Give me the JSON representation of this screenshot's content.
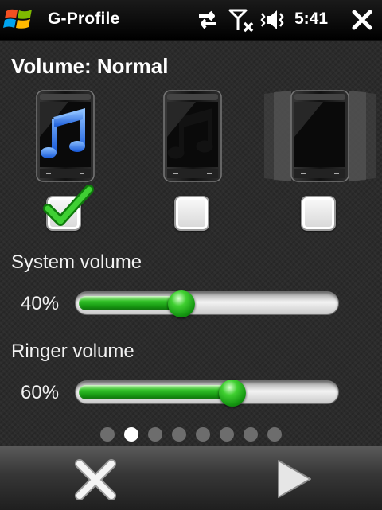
{
  "status_bar": {
    "app_title": "G-Profile",
    "time": "5:41"
  },
  "profile": {
    "heading": "Volume: Normal",
    "options": [
      {
        "icon": "phone-music-icon",
        "checked": true
      },
      {
        "icon": "phone-muted-music-icon",
        "checked": false
      },
      {
        "icon": "phone-vibrate-icon",
        "checked": false
      }
    ]
  },
  "system_volume": {
    "label": "System volume",
    "value_text": "40%",
    "value": 40
  },
  "ringer_volume": {
    "label": "Ringer volume",
    "value_text": "60%",
    "value": 60
  },
  "pager": {
    "total": 8,
    "active_index": 1
  },
  "colors": {
    "accent_green": "#1aa515",
    "music_note_blue": "#3a86ff"
  },
  "soft_keys": {
    "left_icon": "close-icon",
    "right_icon": "next-arrow-icon"
  }
}
